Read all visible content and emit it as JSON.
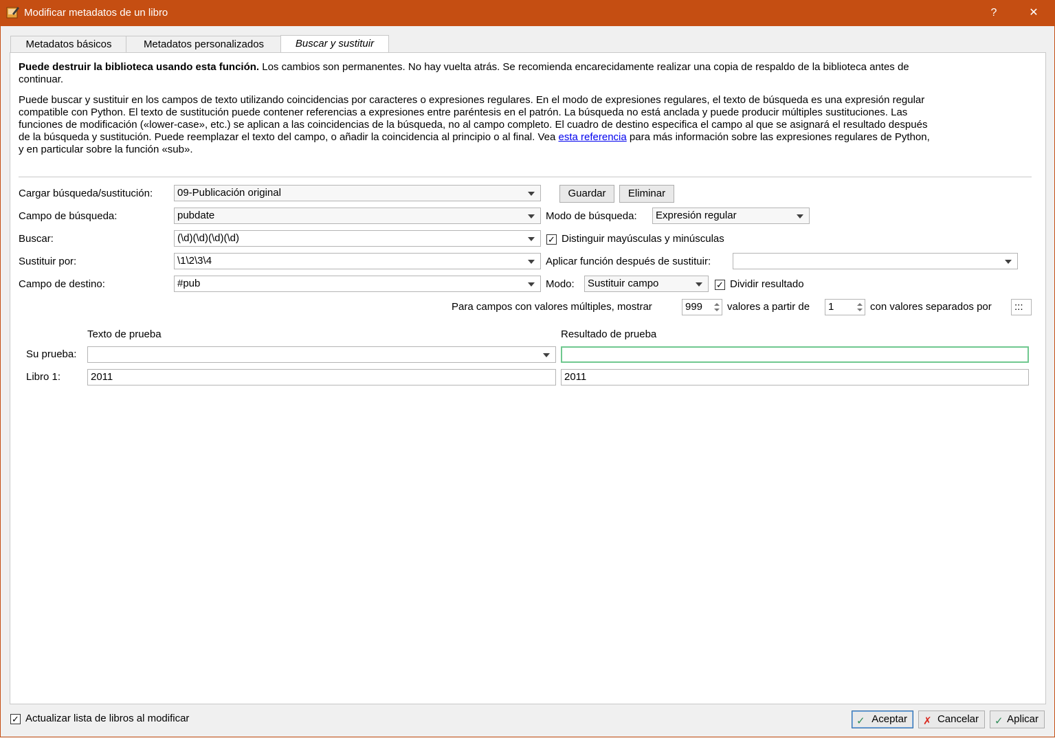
{
  "window": {
    "title": "Modificar metadatos de un libro",
    "help_glyph": "?",
    "close_glyph": "✕",
    "app_icon": "calibre-edit-metadata-icon",
    "accent_color": "#c54e12"
  },
  "tabs": [
    {
      "label": "Metadatos básicos"
    },
    {
      "label": "Metadatos personalizados"
    },
    {
      "label": "Buscar y sustituir"
    }
  ],
  "description": {
    "warning_bold": "Puede destruir la biblioteca usando esta función.",
    "warning_rest": " Los cambios son permanentes. No hay vuelta atrás. Se recomienda encarecidamente realizar una copia de respaldo de la biblioteca antes de",
    "warning_line2": "continuar.",
    "para_1": "Puede buscar y sustituir en los campos de texto utilizando coincidencias por caracteres o expresiones regulares. En el modo de expresiones regulares, el texto de búsqueda es una expresión regular",
    "para_2": "compatible con Python. El texto de sustitución puede contener referencias a expresiones entre paréntesis en el patrón. La búsqueda no está anclada y puede producir múltiples sustituciones. Las",
    "para_3": "funciones de modificación («lower-case», etc.) se aplican a las coincidencias de la búsqueda, no al campo completo. El cuadro de destino especifica el campo al que se asignará el resultado después",
    "para_4": "de la búsqueda y sustitución. Puede reemplazar el texto del campo, o añadir la coincidencia al principio o al final. Vea ",
    "link": "esta referencia",
    "para_4_end": " para más información sobre las expresiones regulares de Python,",
    "para_5": "y en particular sobre la función «sub»."
  },
  "form": {
    "load_label": "Cargar búsqueda/sustitución:",
    "load_value": "09-Publicación original",
    "save_button": "Guardar",
    "delete_button": "Eliminar",
    "search_field_label": "Campo de búsqueda:",
    "search_field_value": "pubdate",
    "search_mode_label": "Modo de búsqueda:",
    "search_mode_value": "Expresión regular",
    "search_label": "Buscar:",
    "search_value": "(\\d)(\\d)(\\d)(\\d)",
    "case_sensitive_label": "Distinguir mayúsculas y minúsculas",
    "case_sensitive_checked": true,
    "replace_label": "Sustituir por:",
    "replace_value": "\\1\\2\\3\\4",
    "apply_function_label": "Aplicar función después de sustituir:",
    "apply_function_value": "",
    "dest_field_label": "Campo de destino:",
    "dest_field_value": "#pub",
    "mode_label": "Modo:",
    "mode_value": "Sustituir campo",
    "split_result_label": "Dividir resultado",
    "split_result_checked": true,
    "multi_prefix": "Para campos con valores múltiples, mostrar",
    "multi_count": "999",
    "multi_middle": "valores a partir de",
    "multi_start": "1",
    "multi_suffix": "con valores separados por",
    "multi_separator": ":::"
  },
  "test": {
    "text_header": "Texto de prueba",
    "result_header": "Resultado de prueba",
    "your_test_label": "Su prueba:",
    "your_test_value": "",
    "your_test_result": "",
    "book1_label": "Libro 1:",
    "book1_value": "2011",
    "book1_result": "2011"
  },
  "footer": {
    "update_list_label": "Actualizar lista de libros al modificar",
    "update_list_checked": true,
    "ok_button": "Aceptar",
    "cancel_button": "Cancelar",
    "apply_button": "Aplicar"
  }
}
